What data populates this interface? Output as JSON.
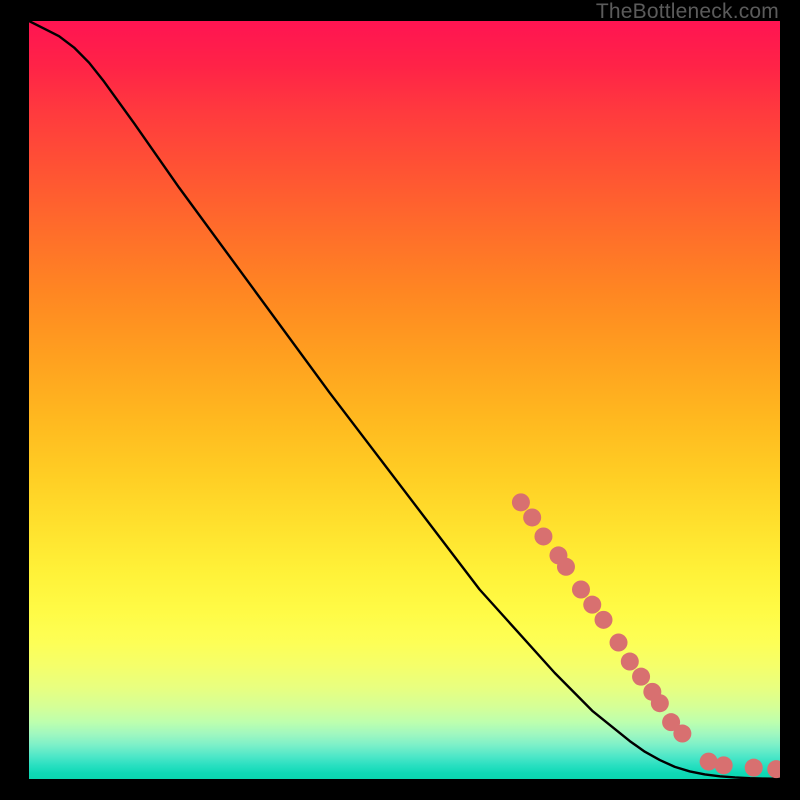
{
  "watermark": "TheBottleneck.com",
  "chart_data": {
    "type": "line",
    "title": "",
    "xlabel": "",
    "ylabel": "",
    "xlim": [
      0,
      100
    ],
    "ylim": [
      0,
      100
    ],
    "background": "heat-gradient",
    "series": [
      {
        "name": "bottleneck-curve",
        "color": "#000000",
        "x": [
          0,
          2,
          4,
          6,
          8,
          10,
          14,
          20,
          30,
          40,
          50,
          60,
          65,
          70,
          75,
          80,
          82,
          84,
          86,
          88,
          90,
          92,
          94,
          96,
          98,
          100
        ],
        "y": [
          100,
          99,
          98,
          96.5,
          94.5,
          92,
          86.5,
          78,
          64.5,
          51,
          38,
          25,
          19.5,
          14,
          9,
          5,
          3.6,
          2.5,
          1.6,
          1.0,
          0.6,
          0.35,
          0.2,
          0.1,
          0.05,
          0.03
        ]
      }
    ],
    "markers": [
      {
        "name": "highlighted-points",
        "color": "#d87070",
        "radius": 9,
        "points": [
          {
            "x": 65.5,
            "y": 36.5
          },
          {
            "x": 67.0,
            "y": 34.5
          },
          {
            "x": 68.5,
            "y": 32.0
          },
          {
            "x": 70.5,
            "y": 29.5
          },
          {
            "x": 71.5,
            "y": 28.0
          },
          {
            "x": 73.5,
            "y": 25.0
          },
          {
            "x": 75.0,
            "y": 23.0
          },
          {
            "x": 76.5,
            "y": 21.0
          },
          {
            "x": 78.5,
            "y": 18.0
          },
          {
            "x": 80.0,
            "y": 15.5
          },
          {
            "x": 81.5,
            "y": 13.5
          },
          {
            "x": 83.0,
            "y": 11.5
          },
          {
            "x": 84.0,
            "y": 10.0
          },
          {
            "x": 85.5,
            "y": 7.5
          },
          {
            "x": 87.0,
            "y": 6.0
          },
          {
            "x": 90.5,
            "y": 2.3
          },
          {
            "x": 92.5,
            "y": 1.8
          },
          {
            "x": 96.5,
            "y": 1.5
          },
          {
            "x": 99.5,
            "y": 1.3
          }
        ]
      }
    ]
  }
}
